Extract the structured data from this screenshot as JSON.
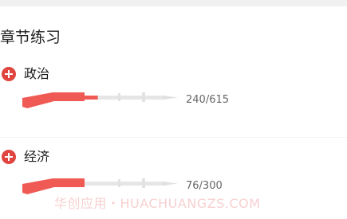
{
  "section": {
    "title": "章节练习"
  },
  "subjects": [
    {
      "name": "政治",
      "done": 240,
      "total": 615,
      "count_label": "240/615",
      "icon": "plus-circle-icon"
    },
    {
      "name": "经济",
      "done": 76,
      "total": 300,
      "count_label": "76/300",
      "icon": "plus-circle-icon"
    }
  ],
  "watermark": "华创应用・HUACHUANGZS.COM",
  "colors": {
    "accent": "#e0453f",
    "rifle_progress": "#f05a55",
    "rifle_track": "#e6e6e6",
    "count_text": "#666666"
  }
}
